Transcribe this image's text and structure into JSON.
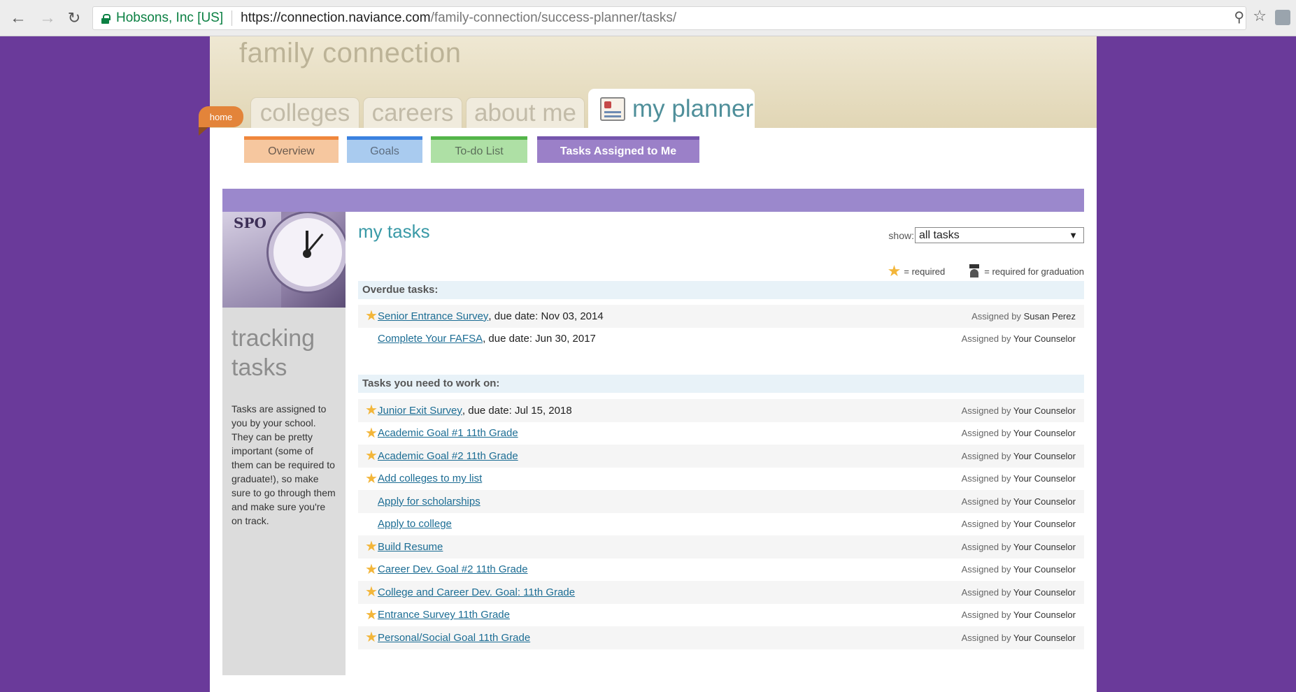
{
  "browser": {
    "site_identity": "Hobsons, Inc [US]",
    "url_host": "https://connection.naviance.com",
    "url_path": "/family-connection/success-planner/tasks/"
  },
  "brand": "family connection",
  "home_tab": "home",
  "main_tabs": {
    "colleges": "colleges",
    "careers": "careers",
    "about_me": "about me",
    "my_planner": "my planner"
  },
  "sub_tabs": {
    "overview": "Overview",
    "goals": "Goals",
    "todo": "To-do List",
    "assigned": "Tasks Assigned to Me"
  },
  "sidebar": {
    "image_text": "SPO",
    "title": "tracking tasks",
    "description": "Tasks are assigned to you by your school. They can be pretty important (some of them can be required to graduate!), so make sure to go through them and make sure you're on track."
  },
  "main": {
    "title": "my tasks",
    "show_label": "show:",
    "show_value": "all tasks",
    "legend_required": "= required",
    "legend_graduation": "= required for graduation"
  },
  "sections": {
    "overdue": "Overdue tasks:",
    "work": "Tasks you need to work on:"
  },
  "assigned_prefix": "Assigned by",
  "overdue_tasks": [
    {
      "name": "Senior Entrance Survey",
      "due": ", due date: Nov 03, 2014",
      "required": true,
      "assignee": "Susan Perez"
    },
    {
      "name": "Complete Your FAFSA",
      "due": ", due date: Jun 30, 2017",
      "required": false,
      "assignee": "Your Counselor"
    }
  ],
  "work_tasks": [
    {
      "name": "Junior Exit Survey",
      "due": ", due date: Jul 15, 2018",
      "required": true,
      "assignee": "Your Counselor"
    },
    {
      "name": "Academic Goal #1 11th Grade",
      "due": "",
      "required": true,
      "assignee": "Your Counselor"
    },
    {
      "name": "Academic Goal #2 11th Grade",
      "due": "",
      "required": true,
      "assignee": "Your Counselor"
    },
    {
      "name": "Add colleges to my list",
      "due": "",
      "required": true,
      "assignee": "Your Counselor"
    },
    {
      "name": "Apply for scholarships",
      "due": "",
      "required": false,
      "assignee": "Your Counselor"
    },
    {
      "name": "Apply to college",
      "due": "",
      "required": false,
      "assignee": "Your Counselor"
    },
    {
      "name": "Build Resume",
      "due": "",
      "required": true,
      "assignee": "Your Counselor"
    },
    {
      "name": "Career Dev. Goal #2 11th Grade",
      "due": "",
      "required": true,
      "assignee": "Your Counselor"
    },
    {
      "name": "College and Career Dev. Goal: 11th Grade",
      "due": "",
      "required": true,
      "assignee": "Your Counselor"
    },
    {
      "name": "Entrance Survey 11th Grade",
      "due": "",
      "required": true,
      "assignee": "Your Counselor"
    },
    {
      "name": "Personal/Social Goal 11th Grade",
      "due": "",
      "required": true,
      "assignee": "Your Counselor"
    }
  ]
}
